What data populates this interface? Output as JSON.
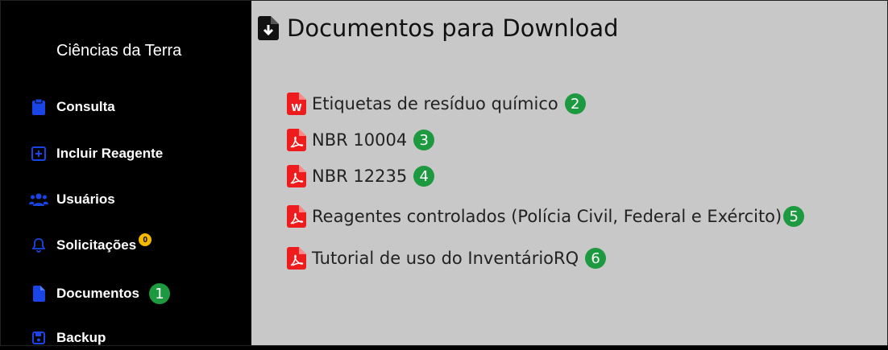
{
  "sidebar": {
    "brand": "Ciências da Terra",
    "items": [
      {
        "label": "Consulta",
        "icon": "clipboard-icon"
      },
      {
        "label": "Incluir Reagente",
        "icon": "plus-square-icon"
      },
      {
        "label": "Usuários",
        "icon": "users-icon"
      },
      {
        "label": "Solicitações",
        "icon": "bell-icon",
        "badge": "0"
      },
      {
        "label": "Documentos",
        "icon": "file-icon",
        "callout": "1"
      },
      {
        "label": "Backup",
        "icon": "save-icon"
      }
    ]
  },
  "main": {
    "title": "Documentos para Download",
    "title_icon": "file-download-icon",
    "documents": [
      {
        "label": "Etiquetas de resíduo químico",
        "icon": "word-file-icon",
        "callout": "2"
      },
      {
        "label": "NBR 10004",
        "icon": "pdf-file-icon",
        "callout": "3"
      },
      {
        "label": "NBR 12235",
        "icon": "pdf-file-icon",
        "callout": "4"
      },
      {
        "label": "Reagentes controlados (Polícia Civil, Federal e Exército)",
        "icon": "pdf-file-icon",
        "callout": "5"
      },
      {
        "label": "Tutorial de uso do InventárioRQ",
        "icon": "pdf-file-icon",
        "callout": "6"
      }
    ]
  },
  "colors": {
    "sidebar_bg": "#000000",
    "main_bg": "#c8c8c8",
    "icon_blue": "#1a45e6",
    "pdf_red": "#ee1c1c",
    "callout_green": "#1d9a3f",
    "badge_yellow": "#f5b800"
  }
}
